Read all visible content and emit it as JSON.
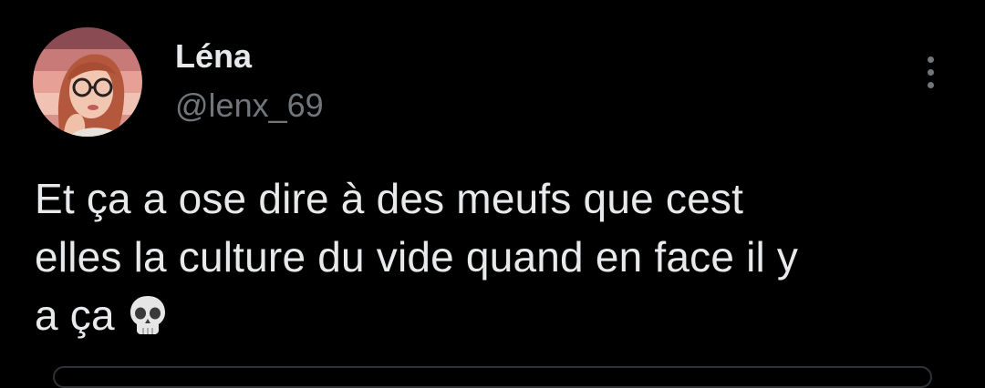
{
  "tweet": {
    "author": {
      "display_name": "Léna",
      "handle": "@lenx_69",
      "avatar": "profile-photo"
    },
    "text_lines": [
      "Et ça a ose dire à des meufs que cest",
      "elles la culture du vide quand en face il y",
      "a ça"
    ],
    "emoji": "skull-emoji",
    "more_icon": "more-vertical-icon"
  },
  "colors": {
    "background": "#000000",
    "primary_text": "#e7e9ea",
    "secondary_text": "#71767b",
    "avatar_stripes": [
      "#8a4b52",
      "#c77a78",
      "#e7a096",
      "#efc2b3",
      "#d8928c"
    ]
  }
}
